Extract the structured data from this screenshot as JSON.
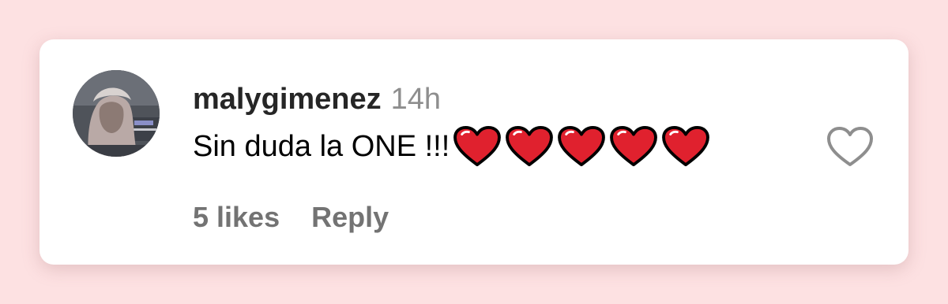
{
  "comment": {
    "username": "malygimenez",
    "time": "14h",
    "text": "Sin duda la ONE !!!",
    "emojis": [
      "heart-emoji",
      "heart-emoji",
      "heart-emoji",
      "heart-emoji",
      "heart-emoji"
    ],
    "likes": "5 likes",
    "reply_label": "Reply",
    "like_icon": "heart-outline-icon"
  },
  "colors": {
    "background": "#fde1e2",
    "card": "#ffffff",
    "username": "#262626",
    "secondary_text": "#737373",
    "heart_emoji": "#e0212e",
    "like_icon_stroke": "#8e8e8e"
  }
}
